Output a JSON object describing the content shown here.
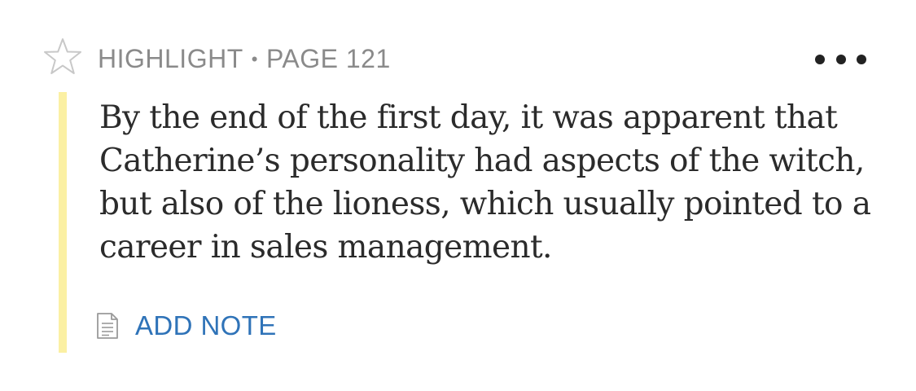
{
  "header": {
    "type_label": "HIGHLIGHT",
    "separator": "•",
    "page_label": "PAGE 121"
  },
  "highlight": {
    "text": "By the end of the first day, it was apparent that Catherine’s personality had aspects of the witch, but also of the lioness, which usually pointed to a career in sales management.",
    "bar_color": "#fbf0a3"
  },
  "actions": {
    "add_note_label": "ADD NOTE"
  },
  "icons": {
    "star": "star-outline-icon",
    "more": "more-horizontal-icon",
    "note": "note-document-icon"
  },
  "colors": {
    "link": "#2f73b8",
    "muted": "#8a8a8a",
    "text": "#2b2b2b"
  }
}
